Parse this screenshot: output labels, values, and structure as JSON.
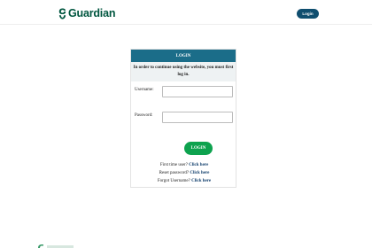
{
  "header": {
    "brand": "Guardian",
    "login_button": "Login"
  },
  "card": {
    "title": "LOGIN",
    "notice": "In order to continue using the website, you must first log in.",
    "username_label": "Username:",
    "username_value": "",
    "password_label": "Password:",
    "password_value": "",
    "submit_label": "LOGIN",
    "links": [
      {
        "prefix": "First time user?",
        "link": "Click here"
      },
      {
        "prefix": "Reset password?",
        "link": "Click here"
      },
      {
        "prefix": "Forgot Username?",
        "link": "Click here"
      }
    ]
  },
  "colors": {
    "brand_green": "#00563f",
    "header_teal": "#1b6d89",
    "button_green": "#0da24e",
    "nav_button": "#0f4e6f"
  },
  "icons": {
    "logo": "guardian-logo-icon"
  }
}
